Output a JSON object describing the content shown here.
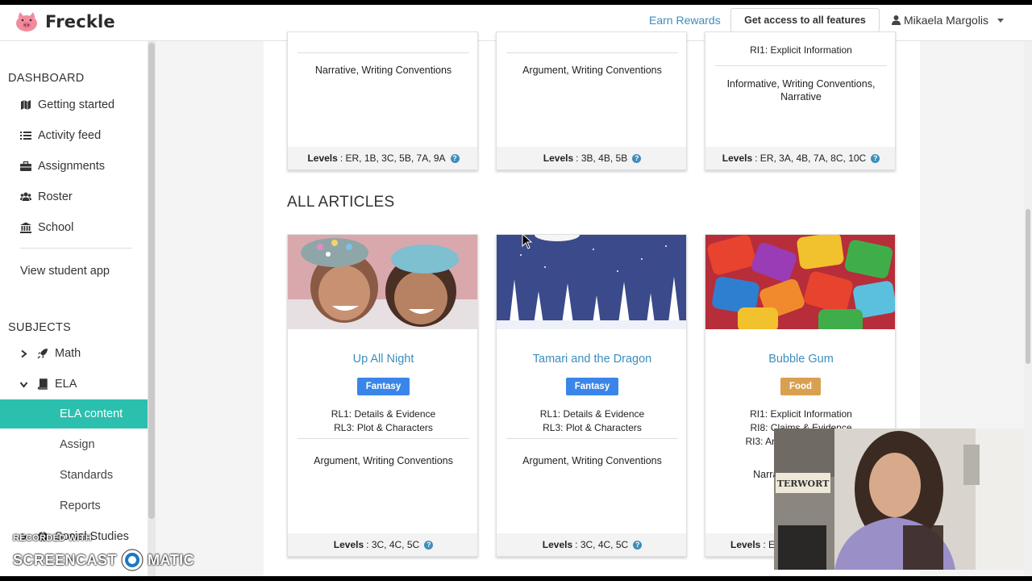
{
  "brand": {
    "name": "Freckle"
  },
  "header": {
    "earn_rewards": "Earn Rewards",
    "access_button": "Get access to all features",
    "user_name": "Mikaela Margolis"
  },
  "sidebar": {
    "dashboard_heading": "DASHBOARD",
    "dashboard_items": [
      {
        "label": "Getting started",
        "icon": "map-icon"
      },
      {
        "label": "Activity feed",
        "icon": "list-icon"
      },
      {
        "label": "Assignments",
        "icon": "briefcase-icon"
      },
      {
        "label": "Roster",
        "icon": "users-icon"
      },
      {
        "label": "School",
        "icon": "institution-icon"
      }
    ],
    "view_student_app": "View student app",
    "subjects_heading": "SUBJECTS",
    "subjects": [
      {
        "label": "Math",
        "icon": "rocket-icon",
        "expanded": false
      },
      {
        "label": "ELA",
        "icon": "book-icon",
        "expanded": true
      },
      {
        "label": "Social Studies",
        "icon": "globe-icon",
        "expanded": false
      }
    ],
    "ela_children": [
      "ELA content",
      "Assign",
      "Standards",
      "Reports"
    ],
    "active_child": "ELA content"
  },
  "top_cards": [
    {
      "standards_visible": "",
      "skills": "Narrative, Writing Conventions",
      "levels_label": "Levels",
      "levels": ": ER, 1B, 3C, 5B, 7A, 9A"
    },
    {
      "standards_visible": "",
      "skills": "Argument, Writing Conventions",
      "levels_label": "Levels",
      "levels": ": 3B, 4B, 5B"
    },
    {
      "standards_visible": "RI1: Explicit Information",
      "skills": "Informative, Writing Conventions, Narrative",
      "levels_label": "Levels",
      "levels": ": ER, 3A, 4B, 7A, 8C, 10C"
    }
  ],
  "section_title": "ALL ARTICLES",
  "articles": [
    {
      "title": "Up All Night",
      "tag": "Fantasy",
      "tag_color": "#3a86e8",
      "standards": [
        "RL1: Details & Evidence",
        "RL3: Plot & Characters"
      ],
      "skills": "Argument, Writing Conventions",
      "levels_label": "Levels",
      "levels": ": 3C, 4C, 5C"
    },
    {
      "title": "Tamari and the Dragon",
      "tag": "Fantasy",
      "tag_color": "#3a86e8",
      "standards": [
        "RL1: Details & Evidence",
        "RL3: Plot & Characters"
      ],
      "skills": "Argument, Writing Conventions",
      "levels_label": "Levels",
      "levels": ": 3C, 4C, 5C"
    },
    {
      "title": "Bubble Gum",
      "tag": "Food",
      "tag_color": "#d9a04f",
      "standards": [
        "RI1: Explicit Information",
        "RI8: Claims & Evidence",
        "RI3: Ana"
      ],
      "skills": "Narrative",
      "levels_label": "Levels",
      "levels": ": ER"
    }
  ],
  "webcam": {
    "sign_text": "TERWORT"
  },
  "watermark": {
    "line1": "RECORDED WITH",
    "line2a": "SCREENCAST",
    "line2b": "MATIC"
  },
  "colors": {
    "accent": "#2bbfae",
    "link": "#3c8dbc",
    "fantasy": "#3a86e8",
    "food": "#d9a04f"
  }
}
